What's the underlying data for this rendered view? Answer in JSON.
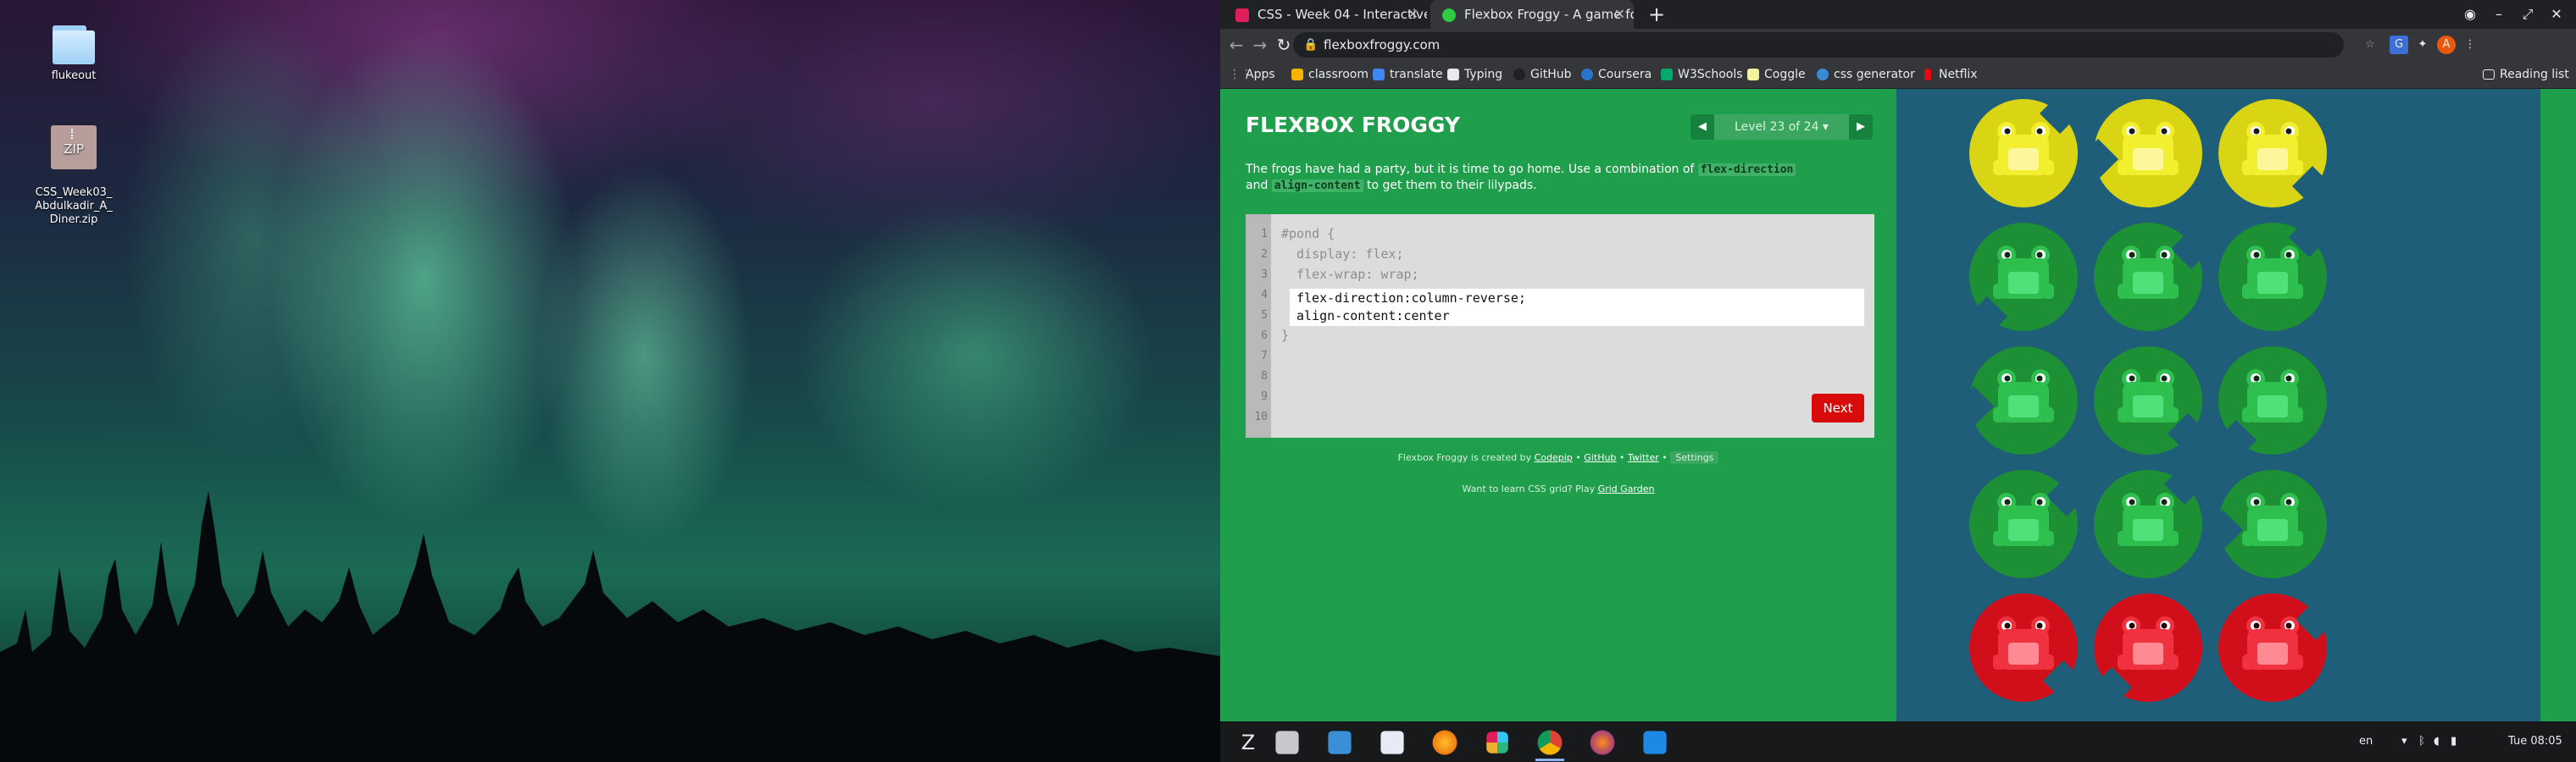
{
  "desktop": {
    "icons": [
      {
        "label": "flukeout",
        "kind": "folder"
      },
      {
        "label": "CSS_Week03_\nAbdulkadir_A_\nDiner.zip",
        "kind": "zip",
        "badge": "ZIP"
      }
    ]
  },
  "browser": {
    "tabs": [
      {
        "title": "CSS - Week 04 - Interactive",
        "active": false,
        "favicon_color": "#e01e5a"
      },
      {
        "title": "Flexbox Froggy - A game fo",
        "active": true,
        "favicon_color": "#2ecc40"
      }
    ],
    "new_tab": "+",
    "url": "flexboxfroggy.com",
    "bookmarks": [
      {
        "label": "Apps",
        "icon": "apps-grid-icon",
        "color": "#9aa0a6"
      },
      {
        "label": "classroom",
        "icon": "classroom-icon",
        "color": "#f4b400"
      },
      {
        "label": "translate",
        "icon": "translate-icon",
        "color": "#4285f4"
      },
      {
        "label": "Typing",
        "icon": "typing-icon",
        "color": "#e8eaed"
      },
      {
        "label": "GitHub",
        "icon": "github-icon",
        "color": "#202124"
      },
      {
        "label": "Coursera",
        "icon": "coursera-icon",
        "color": "#2a73cc"
      },
      {
        "label": "W3Schools",
        "icon": "w3schools-icon",
        "color": "#04aa6d"
      },
      {
        "label": "Coggle",
        "icon": "coggle-icon",
        "color": "#f2f2a0"
      },
      {
        "label": "css generator",
        "icon": "css-generator-icon",
        "color": "#3b8ad6"
      },
      {
        "label": "Netflix",
        "icon": "netflix-icon",
        "color": "#e50914"
      }
    ],
    "reading_list": "Reading list",
    "profile_initial": "A"
  },
  "game": {
    "logo": "FLEXBOX FROGGY",
    "level": "Level 23 of 24 ▾",
    "prev": "◀",
    "next_arrow": "▶",
    "instructions_pre": "The frogs have had a party, but it is time to go home. Use a combination of",
    "chip1": "flex-direction",
    "instructions_mid": "and",
    "chip2": "align-content",
    "instructions_post": "to get them to their lilypads.",
    "line_numbers": [
      "1",
      "2",
      "3",
      "4",
      "5",
      "6",
      "7",
      "8",
      "9",
      "10"
    ],
    "code_before": [
      "#pond {",
      "  display: flex;",
      "  flex-wrap: wrap;"
    ],
    "typed_lines": [
      "flex-direction:column-reverse;",
      "align-content:center"
    ],
    "code_after": "}",
    "next_button": "Next",
    "credits": {
      "prefix": "Flexbox Froggy is created by",
      "codepip": "Codepip",
      "sep": "•",
      "github": "GitHub",
      "twitter": "Twitter",
      "settings": "Settings"
    },
    "grid_garden_prefix": "Want to learn CSS grid? Play",
    "grid_garden_link": "Grid Garden",
    "colors": {
      "yellow": "#e8e21c",
      "green": "#1f9e3a",
      "red": "#e1101d",
      "pond": "#1f5e78",
      "panel": "#1f9e4b"
    },
    "pond_rows": [
      [
        "yellow",
        "yellow",
        "yellow"
      ],
      [
        "green",
        "green",
        "green"
      ],
      [
        "green",
        "green",
        "green"
      ],
      [
        "green",
        "green",
        "green"
      ],
      [
        "red",
        "red",
        "red"
      ]
    ]
  },
  "taskbar": {
    "apps": [
      "zorin-menu-icon",
      "files-icon",
      "screenshot-icon",
      "text-editor-icon",
      "firefox-icon",
      "slack-icon",
      "chrome-icon",
      "firefox-dev-icon",
      "vscode-icon"
    ],
    "language": "en",
    "clock": "Tue 08:05"
  }
}
